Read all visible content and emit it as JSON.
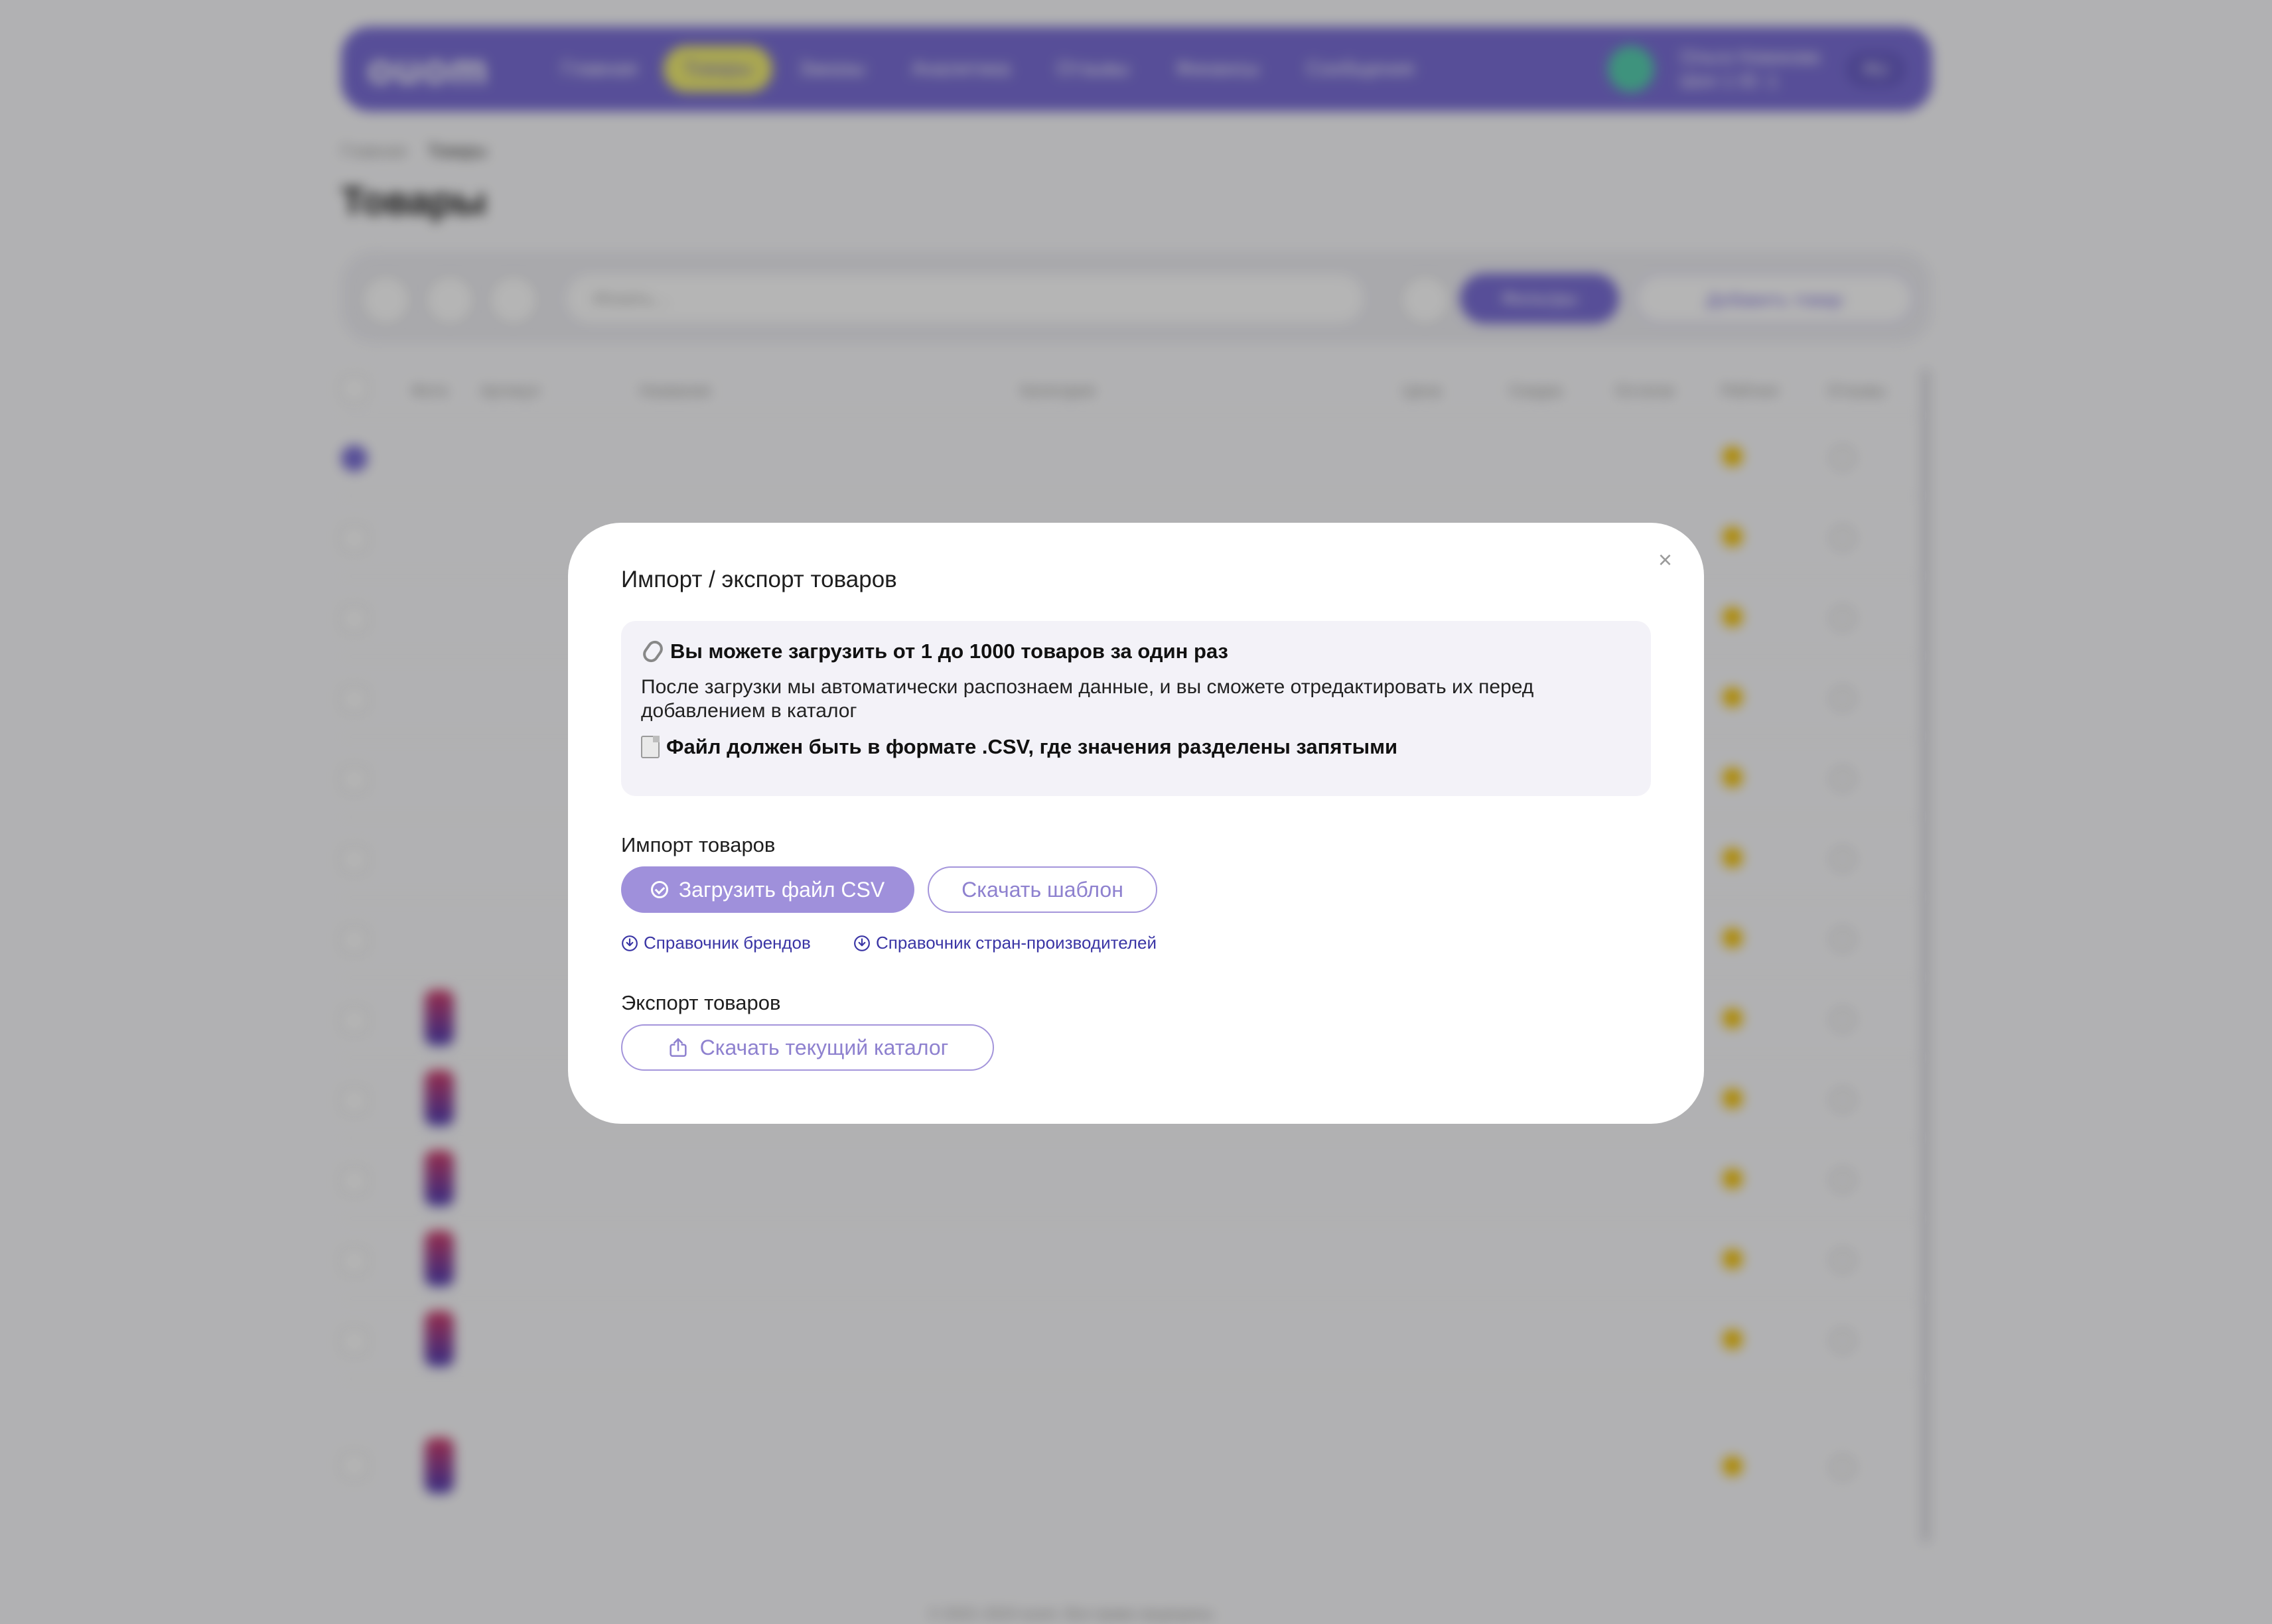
{
  "background": {
    "logo": "ouom",
    "nav": [
      "Главная",
      "Товары",
      "Заказы",
      "Аналитика",
      "Отзывы",
      "Финансы",
      "Сообщения"
    ],
    "nav_active_index": 1,
    "user": {
      "name": "Ольга Новикова",
      "sub": "Шоп 1 ID: 1"
    },
    "lang": "RU",
    "breadcrumb": {
      "root": "Главная",
      "current": "Товары"
    },
    "title": "Товары",
    "search_placeholder": "Искать...",
    "filter_label": "Фильтры",
    "add_label": "Добавить товар",
    "columns": [
      "Фото",
      "Артикул",
      "Название",
      "Категория",
      "Цена",
      "Скидка",
      "Остатки",
      "Рейтинг",
      "Отзывы"
    ],
    "footer": "© 2022–2024 ouom. Все права защищены."
  },
  "modal": {
    "title": "Импорт / экспорт товаров",
    "close": "×",
    "info": {
      "line1": "Вы можете загрузить от 1 до 1000 товаров за один раз",
      "line2": "После загрузки мы автоматически распознаем данные, и вы сможете отредактировать их перед добавлением в каталог",
      "line3": "Файл должен быть в формате .CSV, где значения разделены запятыми"
    },
    "import_label": "Импорт товаров",
    "upload_button": "Загрузить файл CSV",
    "template_button": "Скачать шаблон",
    "brands_link": "Справочник брендов",
    "countries_link": "Справочник стран-производителей",
    "export_label": "Экспорт товаров",
    "export_button": "Скачать текущий каталог"
  },
  "colors": {
    "accent": "#7b6fd6",
    "button_primary": "#9f90db",
    "link": "#3a35a5",
    "info_bg": "#f3f2f8"
  }
}
